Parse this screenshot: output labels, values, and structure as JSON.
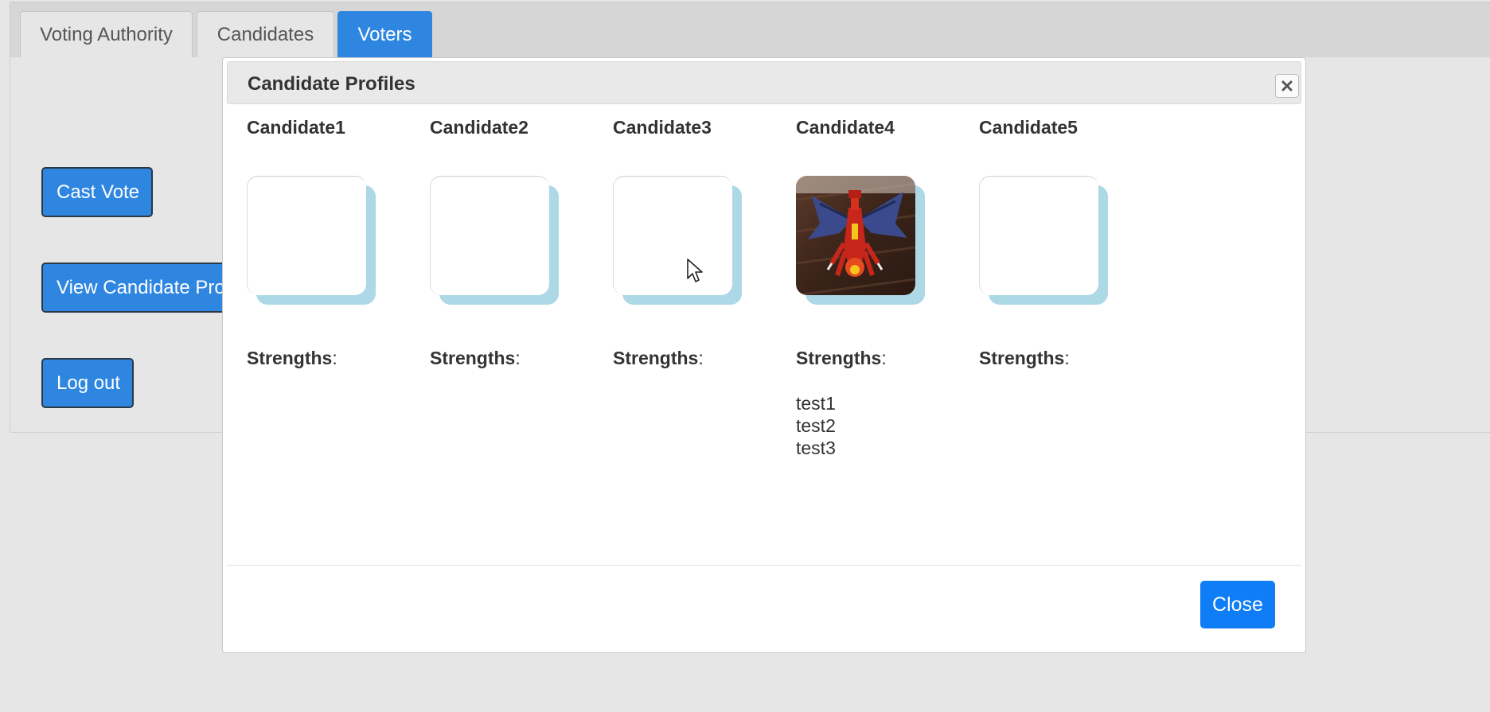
{
  "tabs": [
    {
      "label": "Voting Authority",
      "active": false
    },
    {
      "label": "Candidates",
      "active": false
    },
    {
      "label": "Voters",
      "active": true
    }
  ],
  "actions": {
    "cast_vote": "Cast Vote",
    "view_profiles": "View Candidate Profiles",
    "log_out": "Log out"
  },
  "modal": {
    "title": "Candidate Profiles",
    "close_icon": "close-icon",
    "close_label": "Close",
    "strengths_label": "Strengths",
    "candidates": [
      {
        "name": "Candidate1",
        "has_photo": false,
        "strengths": []
      },
      {
        "name": "Candidate2",
        "has_photo": false,
        "strengths": []
      },
      {
        "name": "Candidate3",
        "has_photo": false,
        "strengths": []
      },
      {
        "name": "Candidate4",
        "has_photo": true,
        "photo": "red lego dragon on wooden floor",
        "strengths": [
          "test1",
          "test2",
          "test3"
        ]
      },
      {
        "name": "Candidate5",
        "has_photo": false,
        "strengths": []
      }
    ]
  },
  "colors": {
    "primary": "#2f86e0",
    "close_button": "#0f7ef6",
    "photo_shadow": "#add8e6",
    "background": "#e6e6e6"
  }
}
